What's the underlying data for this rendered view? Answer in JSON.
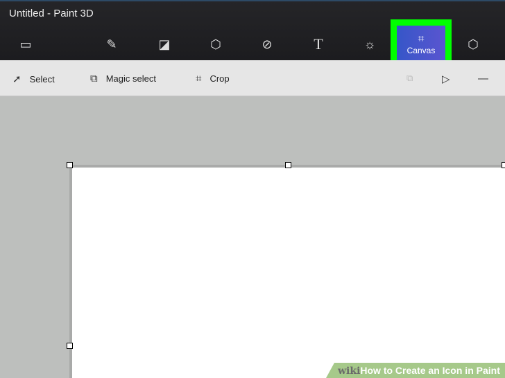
{
  "title": "Untitled - Paint 3D",
  "toolbar": {
    "canvas_label": "Canvas"
  },
  "subtoolbar": {
    "select": "Select",
    "magic_select": "Magic select",
    "crop": "Crop"
  },
  "watermark": {
    "brand": "wiki",
    "text": "How to Create an Icon in Paint"
  }
}
